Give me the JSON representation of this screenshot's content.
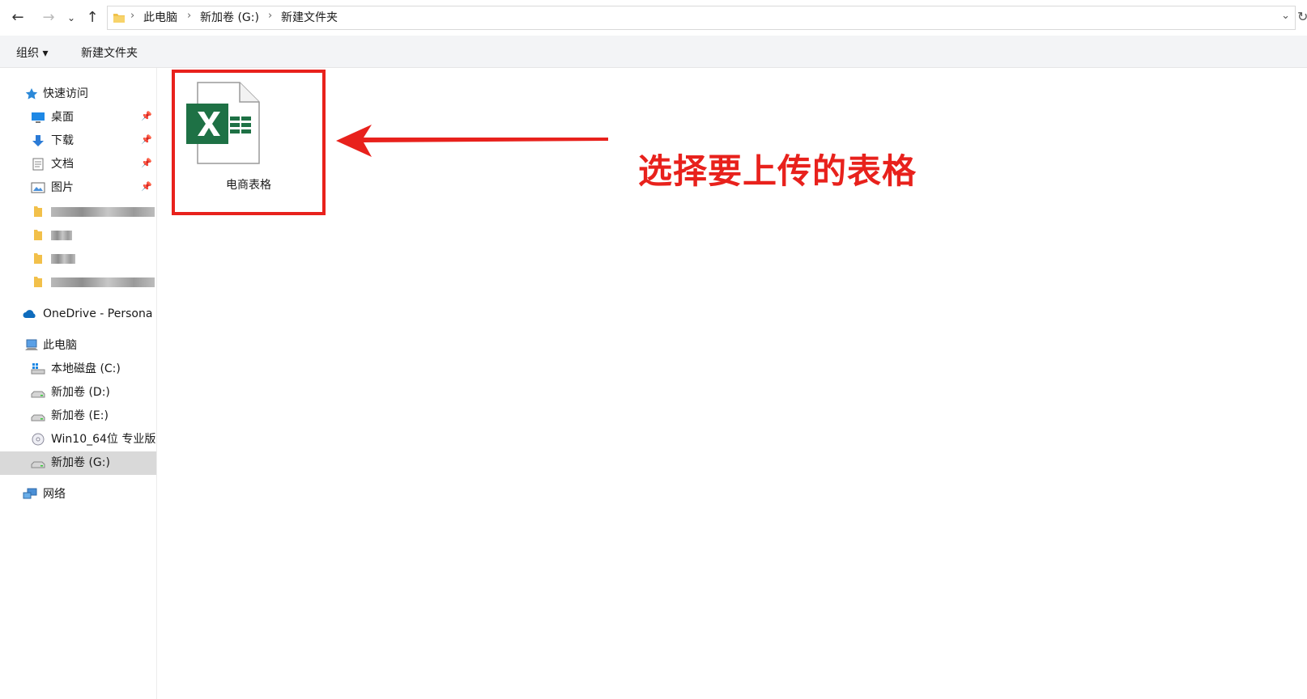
{
  "address": {
    "breadcrumbs": [
      "此电脑",
      "新加卷 (G:)",
      "新建文件夹"
    ]
  },
  "toolbar": {
    "organize_label": "组织 ▾",
    "new_folder_label": "新建文件夹"
  },
  "sidebar": {
    "quick_access": "快速访问",
    "desktop": "桌面",
    "downloads": "下载",
    "documents": "文档",
    "pictures": "图片",
    "onedrive": "OneDrive - Persona",
    "this_pc": "此电脑",
    "drive_c": "本地磁盘 (C:)",
    "drive_d": "新加卷 (D:)",
    "drive_e": "新加卷 (E:)",
    "drive_dvd": "Win10_64位 专业版",
    "drive_g": "新加卷 (G:)",
    "network": "网络"
  },
  "content": {
    "file_name": "电商表格",
    "annotation": "选择要上传的表格"
  },
  "colors": {
    "accent_red": "#e8211c",
    "excel_green": "#1e7145",
    "selection_gray": "#d9d9d9"
  }
}
